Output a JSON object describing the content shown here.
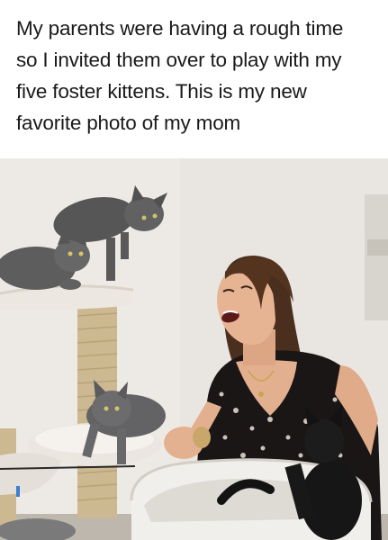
{
  "caption": {
    "lines": [
      "My parents were having a rough time",
      "so I invited them over to play with my",
      "five foster kittens. This is my new",
      "favorite photo of my mom"
    ]
  },
  "photo": {
    "subjects": [
      "laughing-woman",
      "gray-kitten",
      "gray-kitten",
      "gray-kitten",
      "black-kitten",
      "cat-tree",
      "cat-bed"
    ],
    "colors": {
      "wall": "#e9e6e2",
      "kitten_gray": "#5e5d5e",
      "hair": "#4a2e1e",
      "skin": "#e2b08f",
      "dress": "#1a1616",
      "sisal": "#cdb991",
      "fleece": "#f1efec"
    }
  }
}
